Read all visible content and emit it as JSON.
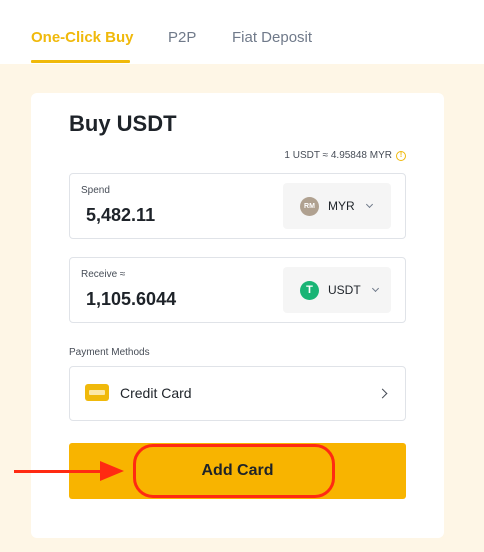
{
  "tabs": [
    {
      "label": "One-Click Buy",
      "active": true
    },
    {
      "label": "P2P",
      "active": false
    },
    {
      "label": "Fiat Deposit",
      "active": false
    }
  ],
  "card": {
    "title": "Buy USDT",
    "rate": "1 USDT ≈ 4.95848 MYR",
    "spend": {
      "label": "Spend",
      "value": "5,482.11",
      "currency": {
        "code": "MYR",
        "icon": "RM"
      }
    },
    "receive": {
      "label": "Receive ≈",
      "value": "1,105.6044",
      "currency": {
        "code": "USDT",
        "icon": "T"
      }
    },
    "payment": {
      "label": "Payment Methods",
      "method": "Credit Card"
    },
    "add_button": "Add Card"
  },
  "colors": {
    "accent": "#f0b90b",
    "button": "#f8b400",
    "backdrop": "#fef6e6",
    "annotation": "#ff2a12"
  }
}
